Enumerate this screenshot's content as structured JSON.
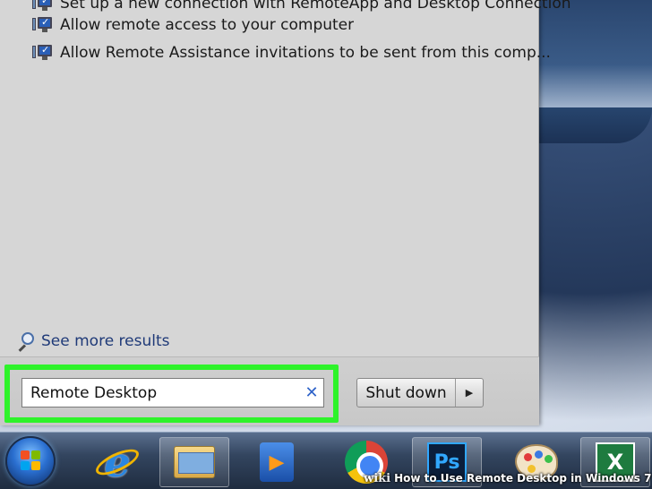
{
  "search_results": {
    "items": [
      {
        "label": "Set up a new connection with RemoteApp and Desktop Connection"
      },
      {
        "label": "Allow remote access to your computer"
      },
      {
        "label": "Allow Remote Assistance invitations to be sent from this comp..."
      }
    ],
    "see_more": "See more results"
  },
  "search": {
    "value": "Remote Desktop",
    "clear_glyph": "✕"
  },
  "shutdown": {
    "label": "Shut down",
    "arrow_glyph": "▶"
  },
  "highlight": {
    "color": "#2ef32a"
  },
  "taskbar": {
    "apps": [
      {
        "icon": "windows-start-orb"
      },
      {
        "icon": "internet-explorer-icon"
      },
      {
        "icon": "windows-explorer-icon"
      },
      {
        "icon": "windows-media-player-icon"
      },
      {
        "icon": "google-chrome-icon"
      },
      {
        "icon": "photoshop-icon",
        "text": "Ps"
      },
      {
        "icon": "paint-icon"
      },
      {
        "icon": "excel-icon",
        "text": "X"
      }
    ]
  },
  "watermark": {
    "brand": "wiki",
    "text": "How to Use Remote Desktop in Windows 7"
  }
}
